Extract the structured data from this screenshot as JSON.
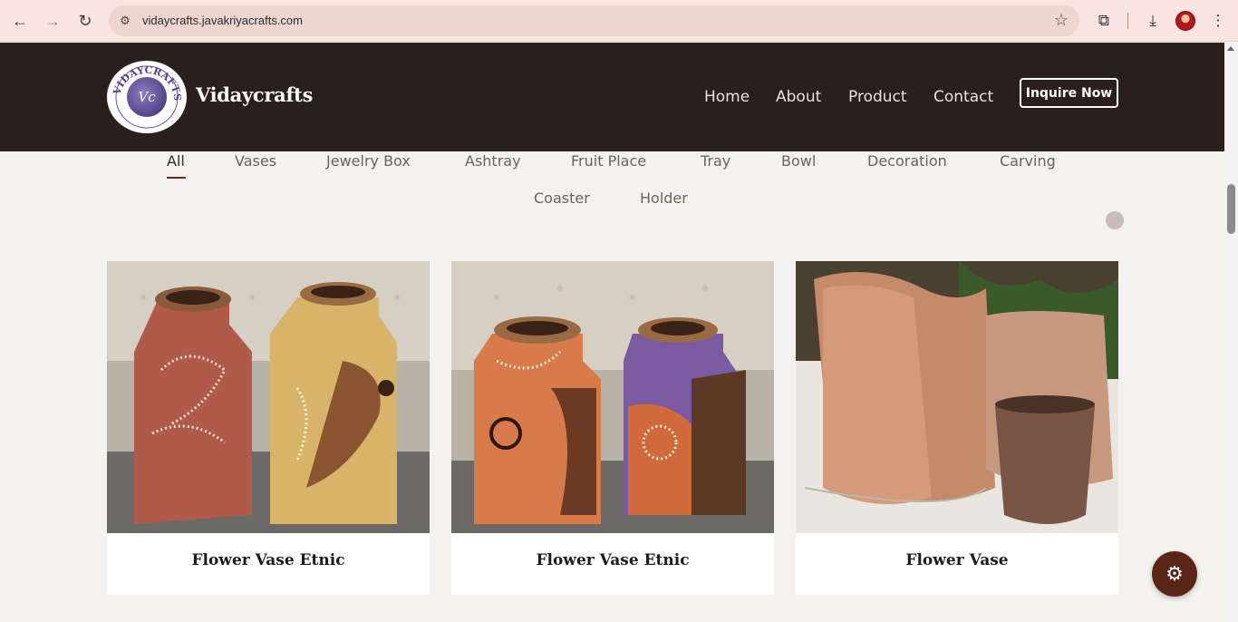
{
  "browser": {
    "url": "vidaycrafts.javakriyacrafts.com"
  },
  "header": {
    "brand": "Vidaycrafts",
    "logo_text": "VIDAYCRAFTS",
    "logo_monogram": "Vc",
    "nav": [
      {
        "label": "Home"
      },
      {
        "label": "About"
      },
      {
        "label": "Product"
      },
      {
        "label": "Contact"
      }
    ],
    "cta_label": "Inquire Now"
  },
  "categories": [
    {
      "label": "All",
      "active": true
    },
    {
      "label": "Vases"
    },
    {
      "label": "Jewelry Box"
    },
    {
      "label": "Ashtray"
    },
    {
      "label": "Fruit Place"
    },
    {
      "label": "Tray"
    },
    {
      "label": "Bowl"
    },
    {
      "label": "Decoration"
    },
    {
      "label": "Carving"
    },
    {
      "label": "Coaster"
    },
    {
      "label": "Holder"
    }
  ],
  "products": [
    {
      "title": "Flower Vase Etnic"
    },
    {
      "title": "Flower Vase Etnic"
    },
    {
      "title": "Flower Vase"
    }
  ],
  "colors": {
    "header_bg": "#2a1f1a",
    "accent": "#6b2b1a",
    "fab_bg": "#5a2417"
  }
}
